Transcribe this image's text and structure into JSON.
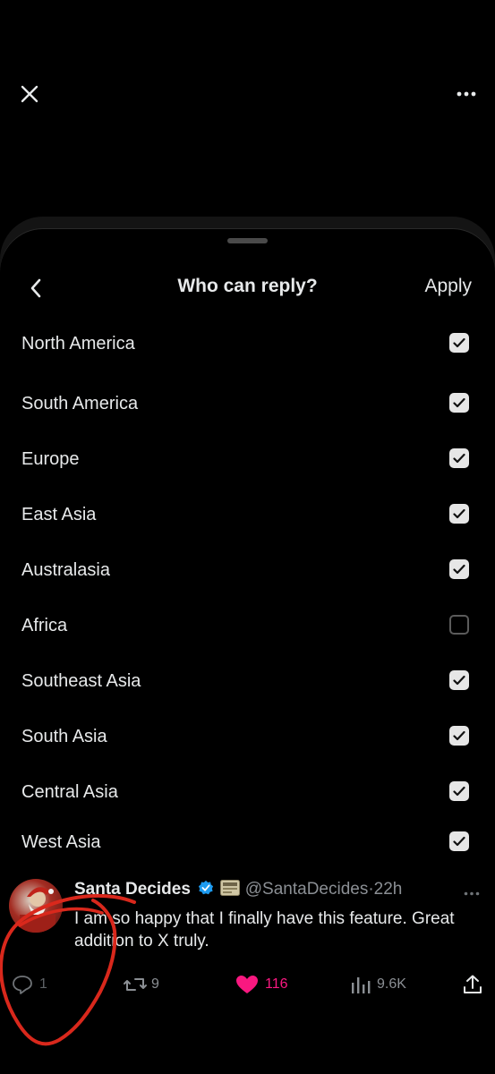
{
  "header": {
    "close_icon": "close-icon",
    "more_icon": "more-horizontal-icon"
  },
  "sheet": {
    "title": "Who can reply?",
    "apply_label": "Apply",
    "back_icon": "chevron-left-icon"
  },
  "regions": [
    {
      "label": "North America",
      "checked": true
    },
    {
      "label": "South America",
      "checked": true
    },
    {
      "label": "Europe",
      "checked": true
    },
    {
      "label": "East Asia",
      "checked": true
    },
    {
      "label": "Australasia",
      "checked": true
    },
    {
      "label": "Africa",
      "checked": false
    },
    {
      "label": "Southeast Asia",
      "checked": true
    },
    {
      "label": "South Asia",
      "checked": true
    },
    {
      "label": "Central Asia",
      "checked": true
    },
    {
      "label": "West Asia",
      "checked": true
    }
  ],
  "tweet": {
    "display_name": "Santa Decides",
    "handle": "@SantaDecides",
    "separator": "·",
    "time": "22h",
    "text": "I am so happy that I finally have this feature. Great addition to X truly.",
    "replies": "1",
    "reposts": "9",
    "likes": "116",
    "views": "9.6K"
  },
  "colors": {
    "background": "#000000",
    "text": "#e7e9ea",
    "muted": "#8b8f94",
    "verified": "#1d9bf0",
    "like": "#f91880",
    "annotation": "#d9281c"
  }
}
